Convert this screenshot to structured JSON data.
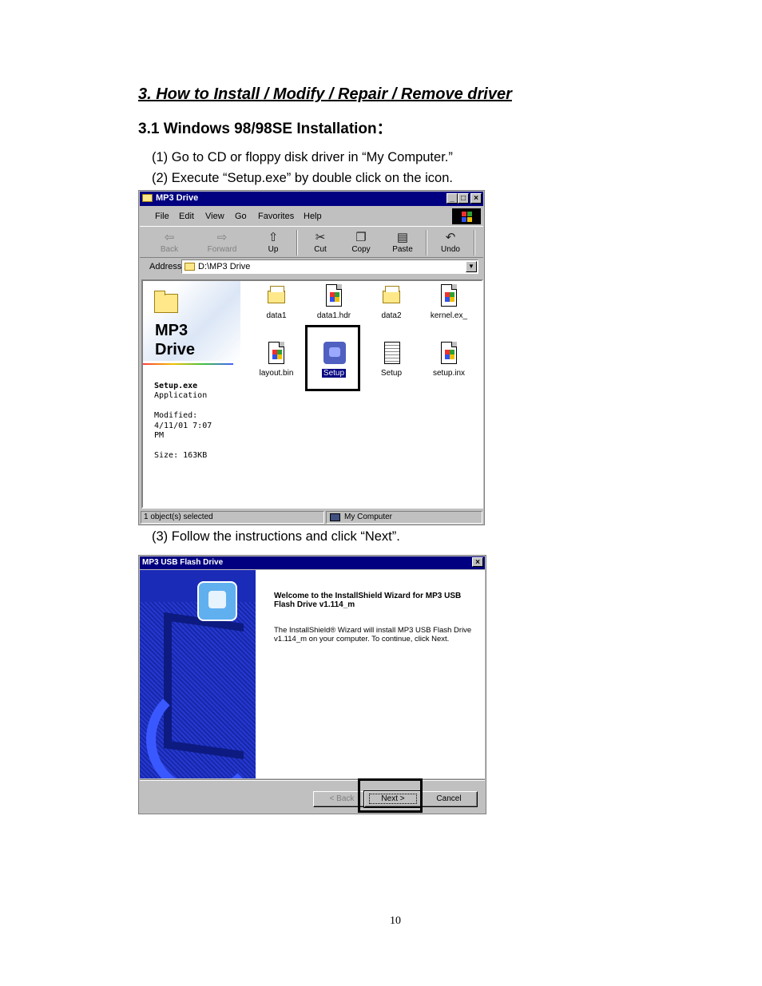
{
  "doc": {
    "heading": "3. How to Install / Modify / Repair / Remove driver",
    "subheading": "3.1 Windows 98/98SE Installation：",
    "step1": "(1) Go to CD or floppy disk driver in “My Computer.”",
    "step2": "(2) Execute “Setup.exe” by double click on the icon.",
    "step3": "(3) Follow the instructions and click “Next”.",
    "page_number": "10"
  },
  "explorer": {
    "title": "MP3 Drive",
    "menu": [
      "File",
      "Edit",
      "View",
      "Go",
      "Favorites",
      "Help"
    ],
    "toolbar": [
      "Back",
      "Forward",
      "Up",
      "Cut",
      "Copy",
      "Paste",
      "Undo"
    ],
    "address_label": "Address",
    "address_value": "D:\\MP3 Drive",
    "left_pane": {
      "title_line1": "MP3",
      "title_line2": "Drive",
      "file_name": "Setup.exe",
      "file_type": "Application",
      "modified_label": "Modified:",
      "modified_value": "4/11/01 7:07",
      "modified_value2": "PM",
      "size": "Size: 163KB"
    },
    "files": [
      "data1",
      "data1.hdr",
      "data2",
      "kernel.ex_",
      "layout.bin",
      "Setup",
      "Setup",
      "setup.inx"
    ],
    "status_left": "1 object(s) selected",
    "status_right": "My Computer"
  },
  "wizard": {
    "title": "MP3 USB Flash Drive",
    "welcome": "Welcome to the InstallShield Wizard for MP3 USB Flash Drive v1.114_m",
    "description": "The InstallShield® Wizard will install MP3 USB Flash Drive v1.114_m on your computer.  To continue, click Next.",
    "back_button": "< Back",
    "next_button": "Next >",
    "cancel_button": "Cancel"
  }
}
